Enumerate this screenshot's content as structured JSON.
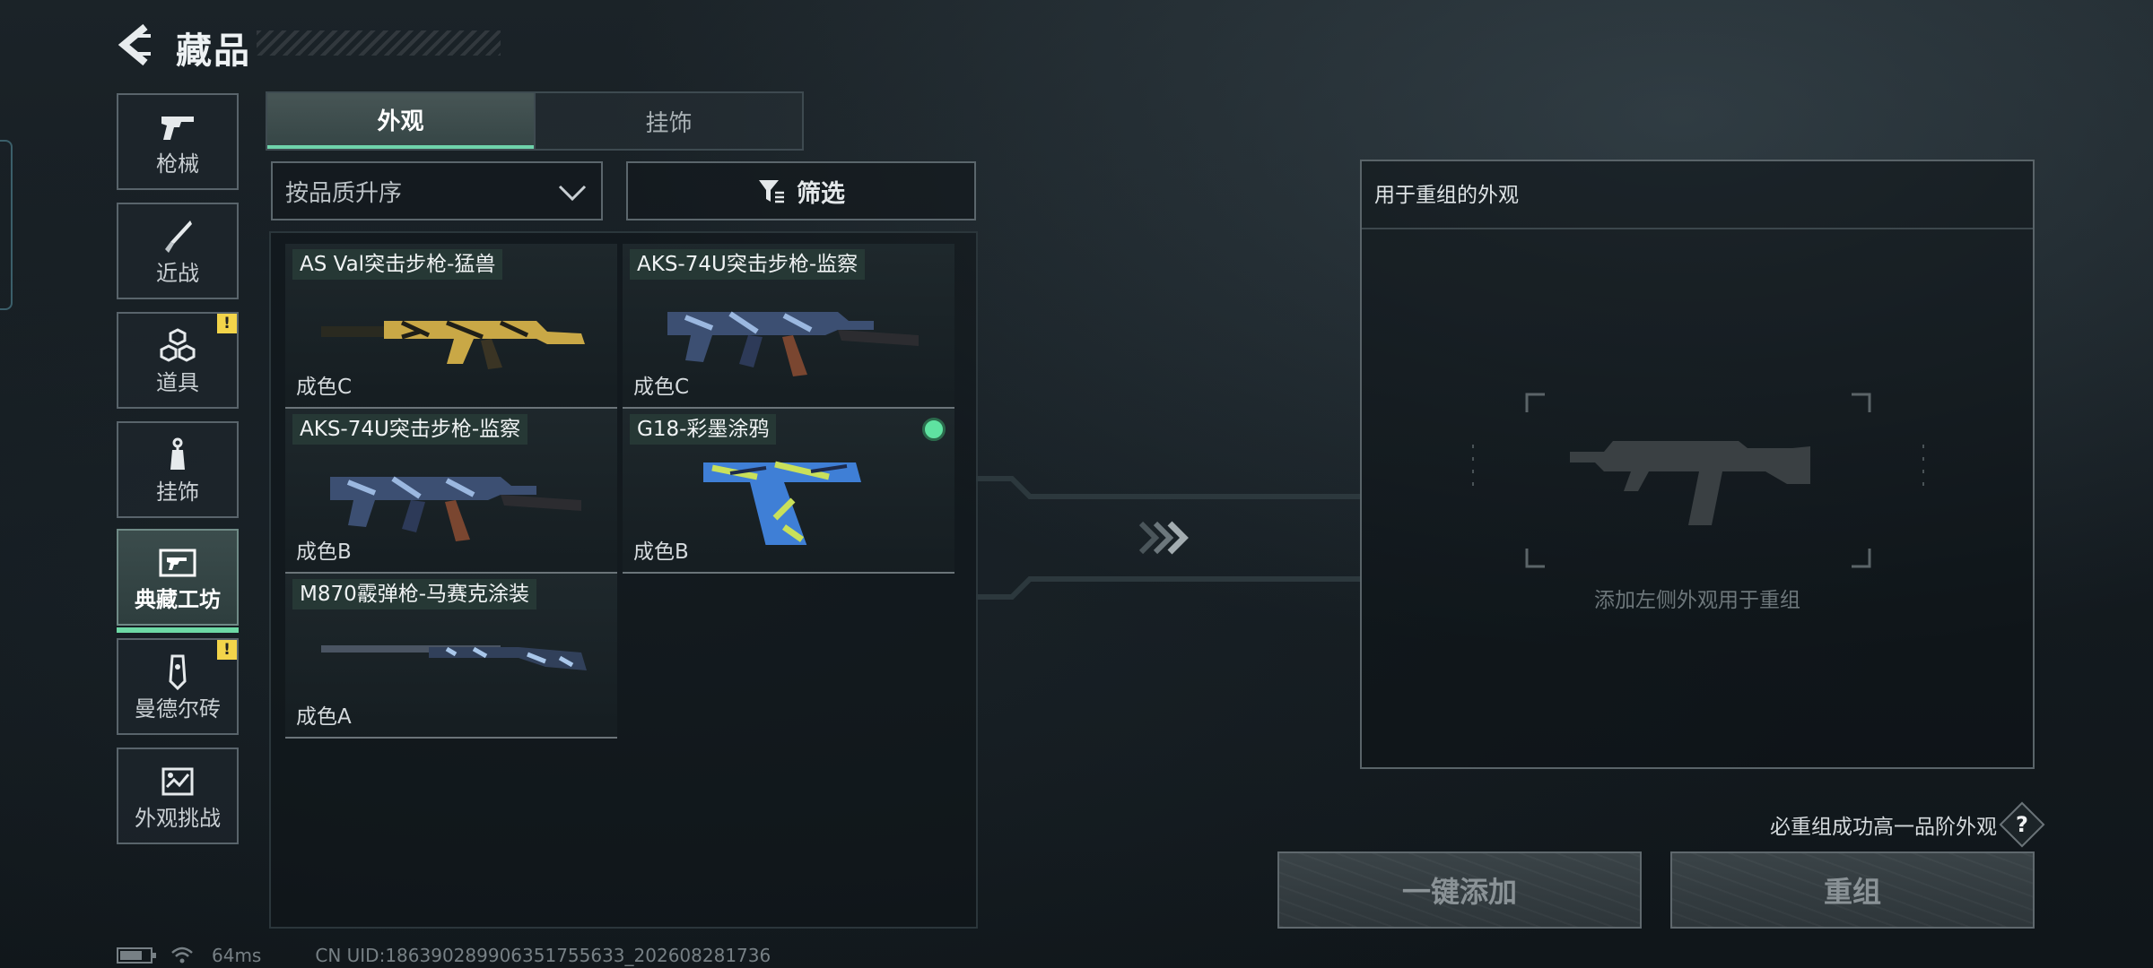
{
  "header": {
    "title": "藏品"
  },
  "sidebar": {
    "items": [
      {
        "label": "枪械",
        "icon": "pistol-icon",
        "active": false,
        "badge": ""
      },
      {
        "label": "近战",
        "icon": "knife-icon",
        "active": false,
        "badge": ""
      },
      {
        "label": "道具",
        "icon": "cubes-icon",
        "active": false,
        "badge": "!"
      },
      {
        "label": "挂饰",
        "icon": "charm-icon",
        "active": false,
        "badge": ""
      },
      {
        "label": "典藏工坊",
        "icon": "workshop-icon",
        "active": true,
        "badge": ""
      },
      {
        "label": "曼德尔砖",
        "icon": "brick-icon",
        "active": false,
        "badge": "!"
      },
      {
        "label": "外观挑战",
        "icon": "challenge-icon",
        "active": false,
        "badge": ""
      }
    ]
  },
  "tabs": [
    {
      "label": "外观",
      "active": true
    },
    {
      "label": "挂饰",
      "active": false
    }
  ],
  "sort": {
    "value": "按品质升序"
  },
  "filter": {
    "label": "筛选"
  },
  "items": [
    {
      "name": "AS Val突击步枪-猛兽",
      "quality": "成色C",
      "selected": false,
      "icon": "rifle-gold-camo-icon"
    },
    {
      "name": "AKS-74U突击步枪-监察",
      "quality": "成色C",
      "selected": false,
      "icon": "rifle-blue-camo-icon"
    },
    {
      "name": "AKS-74U突击步枪-监察",
      "quality": "成色B",
      "selected": false,
      "icon": "rifle-blue-camo-icon"
    },
    {
      "name": "G18-彩墨涂鸦",
      "quality": "成色B",
      "selected": true,
      "icon": "pistol-graffiti-icon"
    },
    {
      "name": "M870霰弹枪-马赛克涂装",
      "quality": "成色A",
      "selected": false,
      "icon": "shotgun-mosaic-icon"
    }
  ],
  "recombine": {
    "title": "用于重组的外观",
    "hint": "添加左侧外观用于重组",
    "success_note": "必重组成功高一品阶外观",
    "help_label": "?",
    "add_all_label": "一键添加",
    "recombine_label": "重组"
  },
  "status": {
    "ping": "64ms",
    "uid": "CN UID:186390289906351755633_202608281736"
  },
  "colors": {
    "accent": "#6fd3ab",
    "badge": "#f3d44a"
  }
}
